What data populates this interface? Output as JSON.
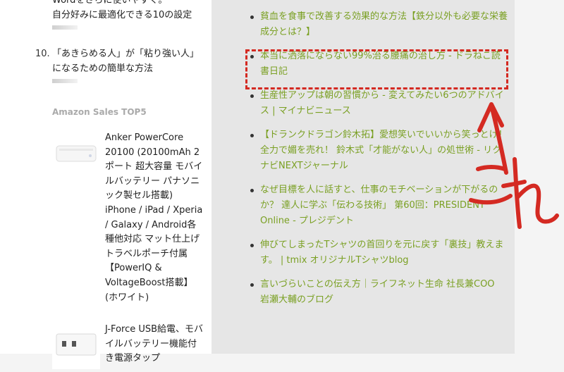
{
  "ranking": {
    "partial_item_top": "Wordをさらに使いやすく。",
    "partial_item_rest": "自分好みに最適化できる10の設定",
    "item10_num": "10.",
    "item10_text": "「あきらめる人」が「粘り強い人」になるための簡単な方法"
  },
  "amazon": {
    "title": "Amazon Sales TOP5",
    "products": [
      {
        "image_icon": "battery-product-icon",
        "text": "Anker PowerCore 20100 (20100mAh 2ポート 超大容量 モバイルバッテリー パナソニック製セル搭載) iPhone / iPad / Xperia / Galaxy / Android各種他対応 マット仕上げ トラベルポーチ付属 【PowerIQ & VoltageBoost搭載】(ホワイト)"
      },
      {
        "image_icon": "usb-charger-product-icon",
        "text": "J-Force USB給電、モバイルバッテリー機能付き電源タップ"
      }
    ]
  },
  "links": [
    "貧血を食事で改善する効果的な方法【鉄分以外も必要な栄養成分とは？】",
    "本当に洒落にならない99%治る腰痛の治し方 - ドラねこ読書日記",
    "生産性アップは朝の習慣から - 変えてみたい6つのアドバイス | マイナビニュース",
    "【ドランクドラゴン鈴木拓】愛想笑いでいいから笑っとけ！ 全力で媚を売れ！ 鈴木式「才能がない人」の処世術 - リクナビNEXTジャーナル",
    "なぜ目標を人に話すと、仕事のモチベーションが下がるのか？ 達人に学ぶ「伝わる技術」 第60回：PRESIDENT Online - プレジデント",
    "伸びてしまったTシャツの首回りを元に戻す「裏技」教えます。 | tmix オリジナルTシャツblog",
    "言いづらいことの伝え方｜ライフネット生命 社長兼COO　岩瀬大輔のブログ"
  ],
  "annotation": {
    "handwritten_text": "これ",
    "color": "#d42a22"
  },
  "colors": {
    "link": "#7aa023",
    "highlight": "#d42a22"
  }
}
